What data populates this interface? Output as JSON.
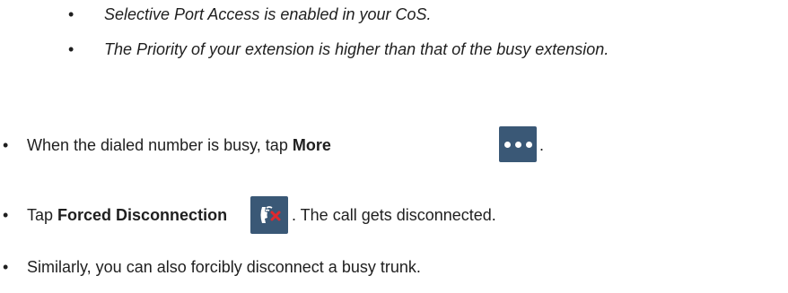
{
  "sub_bullets": [
    "Selective Port Access is enabled in your CoS.",
    "The Priority of your extension is higher than that of the busy extension."
  ],
  "steps": [
    {
      "prefix": "When the dialed number is busy, tap ",
      "bold": "More",
      "suffix": "."
    },
    {
      "prefix": "Tap ",
      "bold": "Forced Disconnection",
      "suffix": ". The call gets disconnected."
    },
    {
      "text": "Similarly, you can also forcibly disconnect a busy trunk."
    }
  ],
  "bullet_symbol": "•",
  "icons": {
    "more": "more-dots-icon",
    "forced_disconnection": "forced-disconnect-icon"
  },
  "colors": {
    "icon_bg": "#3a5876",
    "disconnect_x": "#e0282d"
  }
}
